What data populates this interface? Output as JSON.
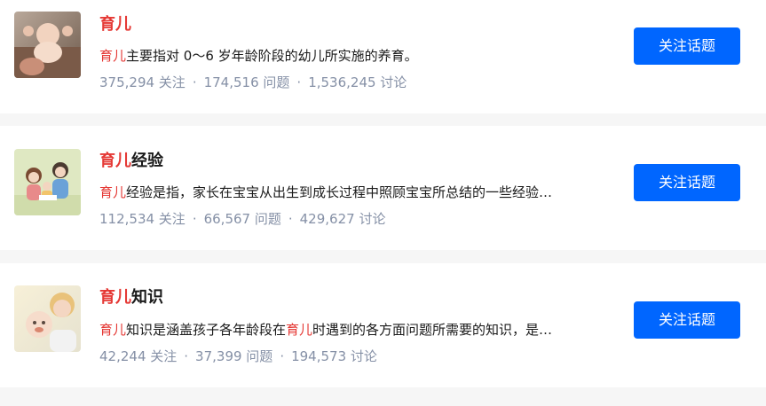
{
  "topics": [
    {
      "title_highlight": "育儿",
      "title_rest": "",
      "desc_parts": [
        {
          "text": "育儿",
          "hl": true
        },
        {
          "text": "主要指对 0～6 岁年龄阶段的幼儿所实施的养育。",
          "hl": false
        }
      ],
      "followers": "375,294 关注",
      "questions": "174,516 问题",
      "discussions": "1,536,245 讨论",
      "sep": "·",
      "button_label": "关注话题",
      "thumb_icon": "baby-photo"
    },
    {
      "title_highlight": "育儿",
      "title_rest": "经验",
      "desc_parts": [
        {
          "text": "育儿",
          "hl": true
        },
        {
          "text": "经验是指，家长在宝宝从出生到成长过程中照顾宝宝所总结的一些经验…",
          "hl": false
        }
      ],
      "followers": "112,534 关注",
      "questions": "66,567 问题",
      "discussions": "429,627 讨论",
      "sep": "·",
      "button_label": "关注话题",
      "thumb_icon": "family-reading-illustration"
    },
    {
      "title_highlight": "育儿",
      "title_rest": "知识",
      "desc_parts": [
        {
          "text": "育儿",
          "hl": true
        },
        {
          "text": "知识是涵盖孩子各年龄段在",
          "hl": false
        },
        {
          "text": "育儿",
          "hl": true
        },
        {
          "text": "时遇到的各方面问题所需要的知识，是…",
          "hl": false
        }
      ],
      "followers": "42,244 关注",
      "questions": "37,399 问题",
      "discussions": "194,573 讨论",
      "sep": "·",
      "button_label": "关注话题",
      "thumb_icon": "mother-baby-photo"
    }
  ],
  "colors": {
    "highlight": "#e53935",
    "button": "#0066ff",
    "stats": "#8590a6"
  }
}
